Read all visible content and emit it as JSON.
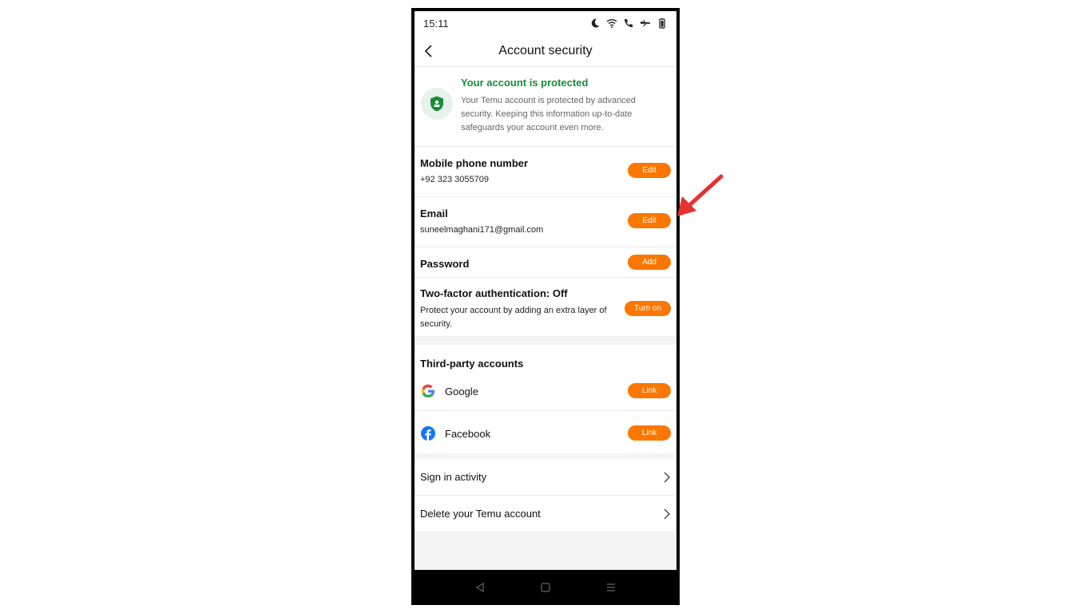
{
  "status": {
    "time": "15:11"
  },
  "header": {
    "title": "Account security"
  },
  "protection": {
    "title": "Your account is protected",
    "description": "Your Temu account is protected by advanced security. Keeping this information up-to-date safeguards your account even more."
  },
  "rows": {
    "phone": {
      "label": "Mobile phone number",
      "value": "+92 323 3055709",
      "button": "Edit"
    },
    "email": {
      "label": "Email",
      "value": "suneelmaghani171@gmail.com",
      "button": "Edit"
    },
    "password": {
      "label": "Password",
      "button": "Add"
    },
    "twofa": {
      "label": "Two-factor authentication: Off",
      "description": "Protect your account by adding an extra layer of security.",
      "button": "Turn on"
    }
  },
  "third_party": {
    "heading": "Third-party accounts",
    "google": {
      "label": "Google",
      "button": "Link"
    },
    "facebook": {
      "label": "Facebook",
      "button": "Link"
    }
  },
  "links": {
    "sign_in_activity": "Sign in activity",
    "delete_account": "Delete your Temu account"
  },
  "colors": {
    "accent": "#fb7701",
    "protected_green": "#1b8a3a",
    "annotation_arrow": "#e8302f"
  },
  "icons": [
    "moon-icon",
    "wifi-icon",
    "wifi-call-icon",
    "airplane-icon",
    "battery-icon",
    "back-icon",
    "shield-icon",
    "google-icon",
    "facebook-icon",
    "chevron-right-icon",
    "nav-back-icon",
    "nav-home-icon",
    "nav-menu-icon"
  ]
}
